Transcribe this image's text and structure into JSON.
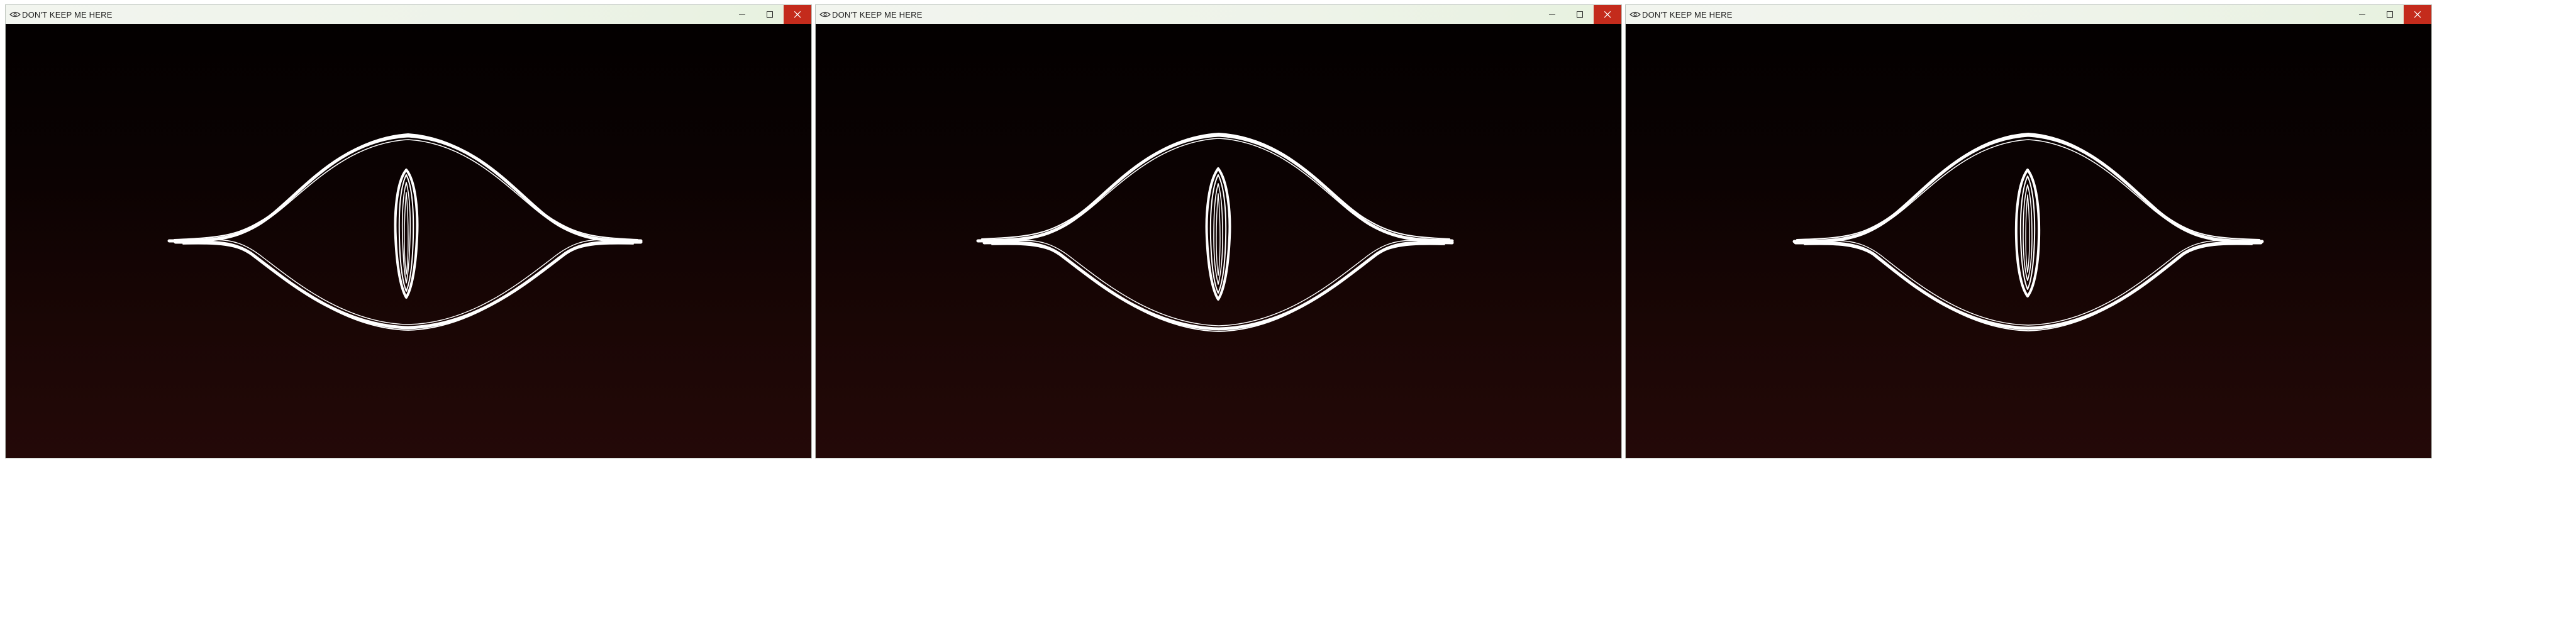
{
  "windows": [
    {
      "title": "DON'T KEEP ME HERE",
      "icon": "eye-icon",
      "controls": [
        "minimize",
        "maximize",
        "close"
      ],
      "close_color": "#c42b1c"
    },
    {
      "title": "DON'T KEEP ME HERE",
      "icon": "eye-icon",
      "controls": [
        "minimize",
        "maximize",
        "close"
      ],
      "close_color": "#c42b1c"
    },
    {
      "title": "DON'T KEEP ME HERE",
      "icon": "eye-icon",
      "controls": [
        "minimize",
        "maximize",
        "close"
      ],
      "close_color": "#c42b1c"
    }
  ],
  "content": {
    "artwork": "sketched-eye-icon",
    "stroke_color": "#ffffff",
    "background_top": "#030000",
    "background_bottom": "#240908"
  }
}
